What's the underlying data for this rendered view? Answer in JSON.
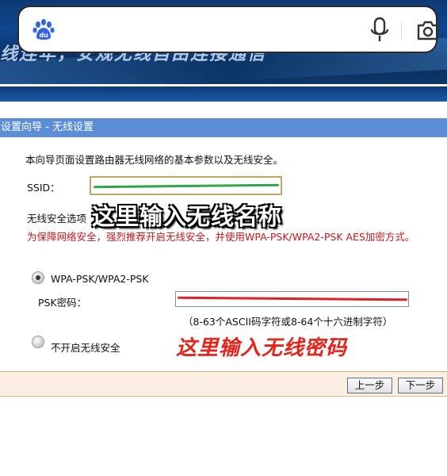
{
  "search": {
    "logo_icon": "baidu-paw-icon",
    "mic_icon": "microphone-icon",
    "camera_icon": "camera-icon"
  },
  "banner": {
    "slogan": "线连年，安规无线自由连接通信"
  },
  "wizard": {
    "title": "设置向导 - 无线设置",
    "intro": "本向导页面设置路由器无线网络的基本参数以及无线安全。",
    "ssid_label": "SSID：",
    "ssid_value": "",
    "security_label": "无线安全选项",
    "warning": "为保障网络安全，强烈推荐开启无线安全，并使用WPA-PSK/WPA2-PSK AES加密方式。",
    "options": {
      "wpa": {
        "label": "WPA-PSK/WPA2-PSK",
        "selected": true
      },
      "off": {
        "label": "不开启无线安全",
        "selected": false
      }
    },
    "psk_label": "PSK密码：",
    "psk_value": "",
    "psk_hint": "（8-63个ASCII码字符或8-64个十六进制字符）",
    "buttons": {
      "prev": "上一步",
      "next": "下一步"
    }
  },
  "annotations": {
    "name_hint": "这里输入无线名称",
    "password_hint": "这里输入无线密码"
  },
  "colors": {
    "header_blue": "#5b8ed6",
    "warning_red": "#c8161d",
    "annotation_red": "#e4231a",
    "ssid_border": "#c9a45c"
  }
}
